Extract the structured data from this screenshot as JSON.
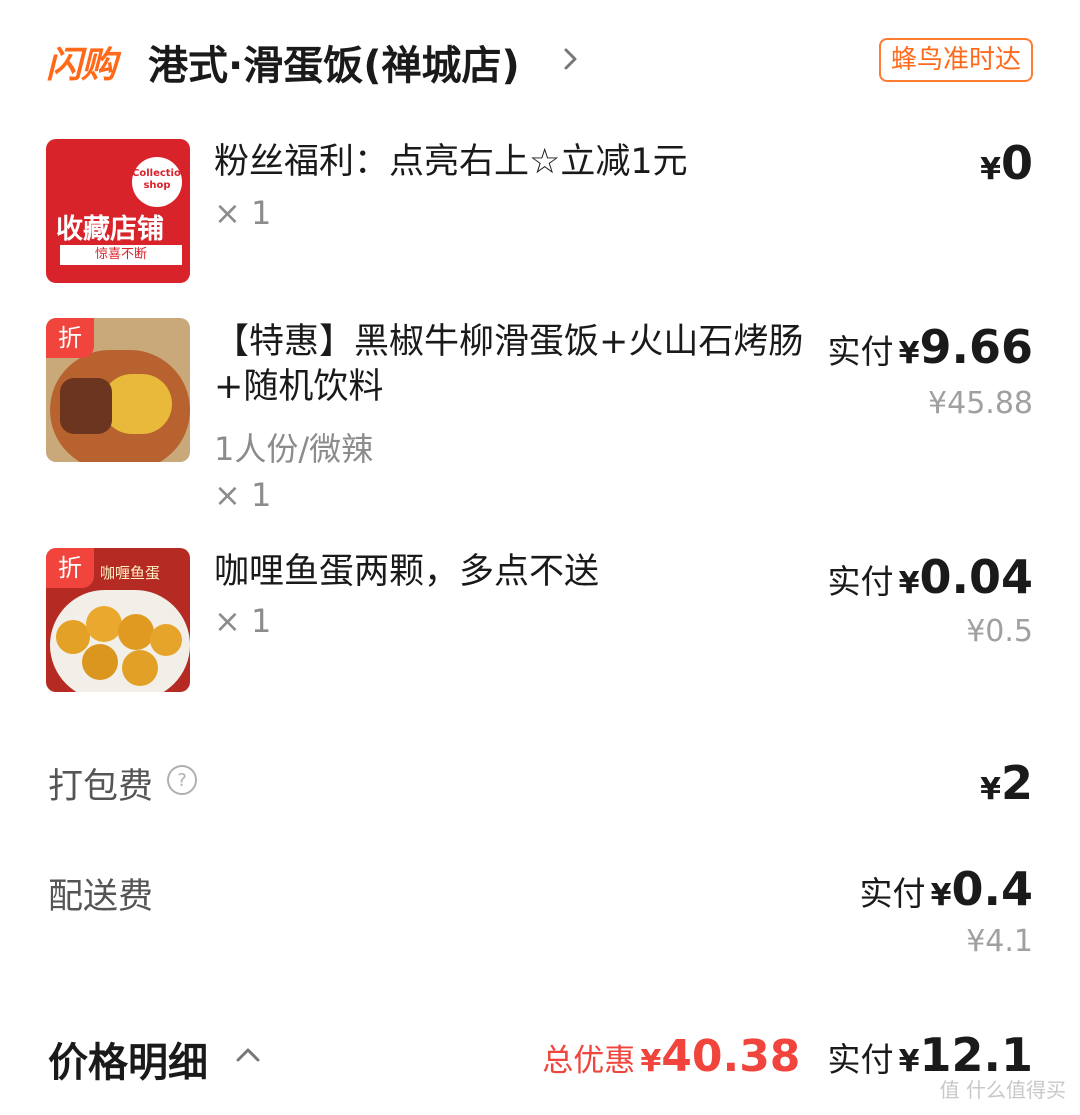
{
  "header": {
    "brand": "闪购",
    "store_name": "港式·滑蛋饭(禅城店)",
    "delivery_badge": "蜂鸟准时达"
  },
  "items": [
    {
      "title": "粉丝福利：点亮右上☆立减1元",
      "qty": "× 1",
      "price": "0",
      "thumb_text_1": "Collection",
      "thumb_text_2": "shop",
      "thumb_text_3": "收藏店铺",
      "thumb_text_4": "惊喜不断"
    },
    {
      "title": "【特惠】黑椒牛柳滑蛋饭+火山石烤肠+随机饮料",
      "spec": "1人份/微辣",
      "qty": "× 1",
      "pay_label": "实付",
      "price": "9.66",
      "orig_price": "¥45.88",
      "badge": "折"
    },
    {
      "title": "咖哩鱼蛋两颗，多点不送",
      "qty": "× 1",
      "pay_label": "实付",
      "price": "0.04",
      "orig_price": "¥0.5",
      "badge": "折",
      "thumb_caption": "咖喱鱼蛋"
    }
  ],
  "fees": {
    "packing_label": "打包费",
    "packing_price": "2",
    "delivery_label": "配送费",
    "delivery_pay_label": "实付",
    "delivery_price": "0.4",
    "delivery_orig": "¥4.1"
  },
  "summary": {
    "title": "价格明细",
    "discount_label": "总优惠",
    "discount_value": "40.38",
    "pay_label": "实付",
    "total": "12.1"
  },
  "currency": "¥",
  "watermark": "值 什么值得买",
  "colors": {
    "accent": "#ff6a1a",
    "discount": "#f0443c",
    "muted": "#8c8c8c"
  }
}
